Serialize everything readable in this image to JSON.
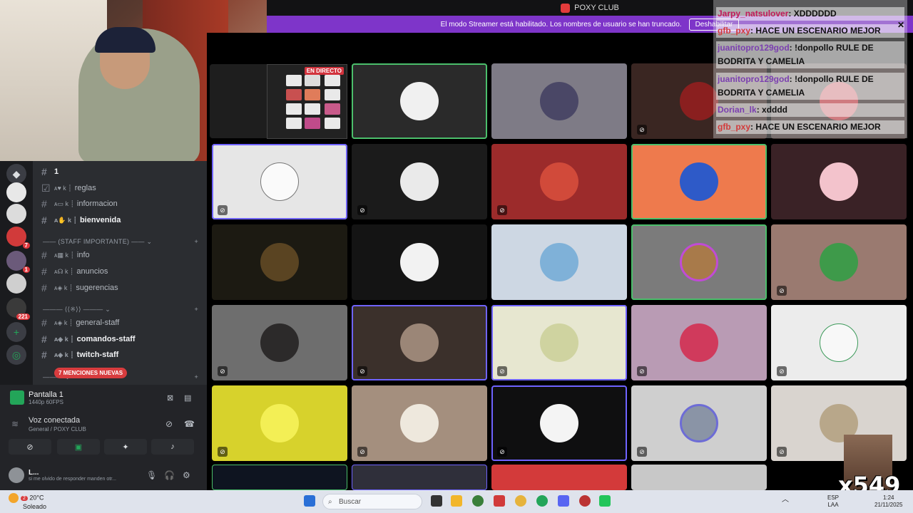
{
  "window": {
    "title": "POXY CLUB"
  },
  "banner": {
    "text": "El modo Streamer está habilitado. Los nombres de usuario se han truncado.",
    "button": "Deshabilitar"
  },
  "preview": {
    "live_label": "EN DIRECTO"
  },
  "channels": [
    {
      "label": "1",
      "bold": true
    },
    {
      "label": "reglas",
      "bold": false
    },
    {
      "label": "informacion",
      "bold": false
    },
    {
      "label": "bienvenida",
      "bold": true
    },
    {
      "label": "info",
      "bold": false
    },
    {
      "label": "anuncios",
      "bold": false
    },
    {
      "label": "sugerencias",
      "bold": false
    },
    {
      "label": "general-staff",
      "bold": false
    },
    {
      "label": "comandos-staff",
      "bold": true
    },
    {
      "label": "twitch-staff",
      "bold": true
    }
  ],
  "categories": {
    "staff": "(STAFF IMPORTANTE)"
  },
  "server_badges": [
    "7",
    "1",
    "221"
  ],
  "mentions": "7 MENCIONES NUEVAS",
  "screen_share": {
    "title": "Pantalla 1",
    "quality": "1440p 60FPS"
  },
  "voice": {
    "status": "Voz conectada",
    "channel": "General / POXY CLUB"
  },
  "user": {
    "name": "L...",
    "status": "si me olvido de responder manden otr..."
  },
  "chat": [
    {
      "user": "Jarpy_natsulover",
      "text": ": XDDDDDD"
    },
    {
      "user": "gfb_pxy",
      "text": ": HACE UN ESCENARIO MEJOR"
    },
    {
      "user": "juanitopro129god",
      "text": ": !donpollo RULE DE BODRITA Y CAMELIA"
    },
    {
      "user": "juanitopro129god",
      "text": ": !donpollo RULE DE BODRITA Y CAMELIA"
    },
    {
      "user": "Dorian_lk",
      "text": ": xdddd"
    },
    {
      "user": "gfb_pxy",
      "text": ": HACE UN ESCENARIO MEJOR"
    }
  ],
  "overlay_counter": "x549",
  "taskbar": {
    "weather_temp": "20°C",
    "weather_desc": "Soleado",
    "weather_badge": "2",
    "search_placeholder": "Buscar",
    "lang": "ESP",
    "lang2": "LAA",
    "time": "1:24",
    "date": "21/11/2025"
  },
  "colors": {
    "accent": "#7e35c9",
    "online": "#23a559",
    "mention": "#d83c3e"
  }
}
